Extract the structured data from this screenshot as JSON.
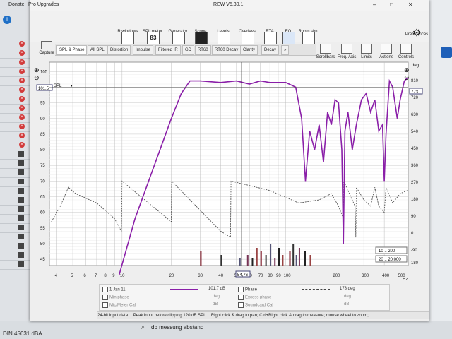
{
  "titlebar": {
    "menu_left": "Donate",
    "menu_upgrades": "Pro Upgrades",
    "title": "REW V5.30.1",
    "minimize": "–",
    "maximize": "□",
    "close": "✕"
  },
  "toolbar": {
    "items": [
      "IR windows",
      "SPL meter",
      "Generator",
      "Scope",
      "Levels",
      "Overlays",
      "RTA",
      "EQ",
      "Room sim"
    ],
    "spl_value": "83",
    "preferences": "Preferences"
  },
  "tabs": [
    "SPL & Phase",
    "All SPL",
    "Distortion",
    "Impulse",
    "Filtered IR",
    "GD",
    "RT60",
    "RT60 Decay",
    "Clarity",
    "Decay",
    "»"
  ],
  "capture": "Capture",
  "right_tools": [
    "Scrollbars",
    "Freq. Axis",
    "Limits",
    "Actions",
    "Controls"
  ],
  "plot": {
    "spl_label": "SPL",
    "left_top_box": "101,5",
    "right_top_box": "773",
    "deg_label": "deg",
    "cursor_box": "54,76",
    "range_1": "10 .. 200",
    "range_2": "20 .. 20,000",
    "left_ticks": [
      "105",
      "100",
      "95",
      "90",
      "85",
      "80",
      "75",
      "70",
      "65",
      "60",
      "55",
      "50",
      "45"
    ],
    "right_ticks": [
      "810",
      "720",
      "630",
      "540",
      "450",
      "360",
      "270",
      "180",
      "90",
      "0",
      "-90"
    ],
    "right_bottom": "180",
    "x_ticks": [
      "4",
      "5",
      "6",
      "7",
      "8",
      "9",
      "10",
      "20",
      "30",
      "40",
      "50",
      "60",
      "70",
      "80",
      "90",
      "100",
      "200",
      "300",
      "400",
      "500"
    ],
    "x_unit": "Hz"
  },
  "legend": {
    "name": "1 Jan 11",
    "spl_value": "101,7 dB",
    "phase_label": "Phase",
    "phase_value": "173 deg",
    "min_phase": "Min phase",
    "min_phase_unit": "deg",
    "excess_phase": "Excess phase",
    "excess_unit": "deg",
    "mic_cal": "Mic/Meter Cal",
    "mic_unit": "dB",
    "soundcard_cal": "Soundcard Cal",
    "soundcard_unit": "dB"
  },
  "status": {
    "bits": "24-bit input data",
    "peak": "Peak input before clipping 120 dB SPL",
    "hint": "Right click & drag to pan; Ctrl+Right click & drag to measure; mouse wheel to zoom;"
  },
  "background": {
    "bottom_left": "DIN 45631 dBA",
    "search_text": "db messung abstand"
  },
  "colors": {
    "spl_trace": "#8a1fa8",
    "phase_trace": "#444444"
  }
}
